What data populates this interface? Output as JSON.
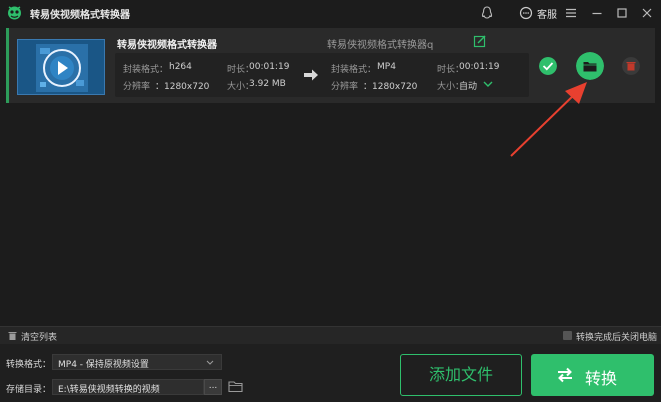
{
  "app": {
    "title": "转易侠视频格式转换器",
    "support_label": "客服"
  },
  "file": {
    "title": "转易侠视频格式转换器",
    "output_name": "转易侠视频格式转换器q",
    "source": {
      "format_label": "封装格式：",
      "format": "h264",
      "duration_label": "时长：",
      "duration": "00:01:19",
      "resolution_label": "分辨率",
      "resolution": "：1280x720",
      "size_label": "大小：",
      "size": "3.92 MB"
    },
    "target": {
      "format_label": "封装格式：",
      "format": "MP4",
      "duration_label": "时长：",
      "duration": "00:01:19",
      "resolution_label": "分辨率",
      "resolution": "：1280x720",
      "size_label": "大小：",
      "size": "自动"
    }
  },
  "list_bar": {
    "clear_label": "清空列表",
    "shutdown_label": "转换完成后关闭电脑"
  },
  "bottom": {
    "format_label": "转换格式：",
    "format_value": "MP4 - 保持原视频设置",
    "dir_label": "存储目录：",
    "dir_value": "E:\\转易侠视频转换的视频",
    "browse_label": "...",
    "add_label": "添加文件",
    "convert_label": "转换"
  },
  "colors": {
    "accent": "#2fbf6c",
    "delete": "#c0392b",
    "arrow": "#e8402f"
  }
}
